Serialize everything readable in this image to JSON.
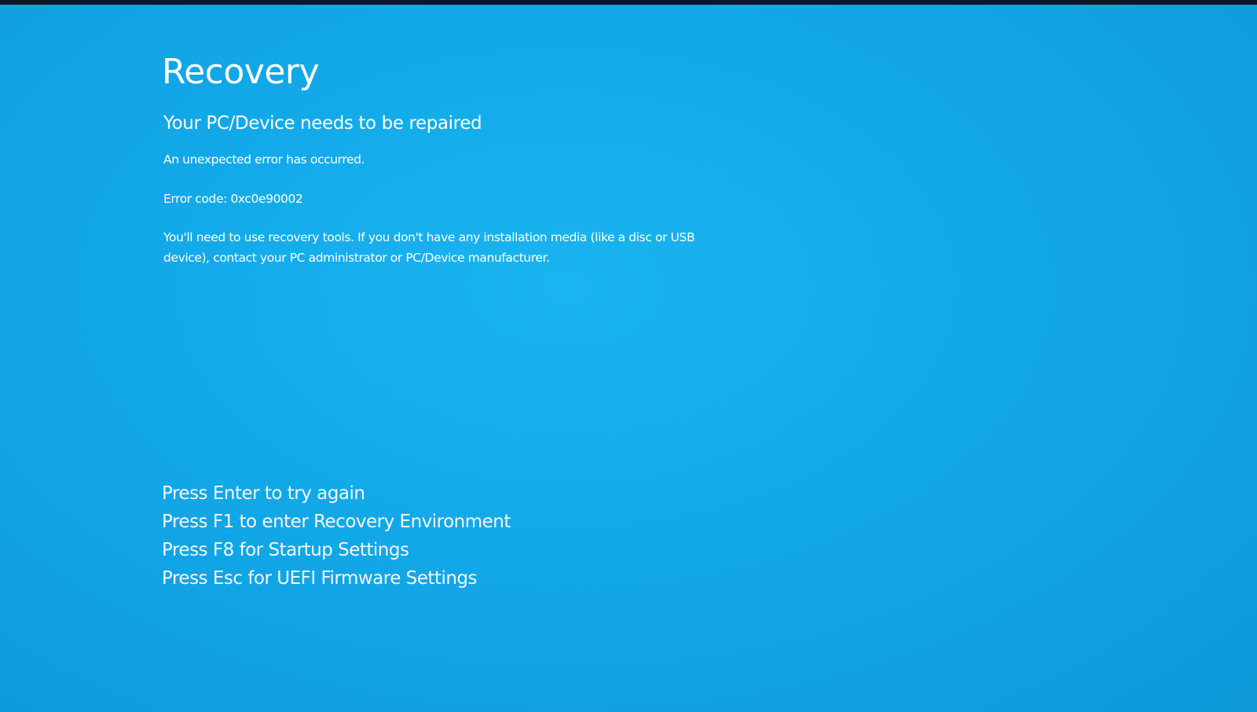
{
  "screen": {
    "title": "Recovery",
    "subtitle": "Your PC/Device needs to be repaired",
    "error_message": "An unexpected error has occurred.",
    "error_code": "Error code: 0xc0e90002",
    "tools_message": "You'll need to use recovery tools. If you don't have any installation media (like a disc or USB device), contact your PC administrator or PC/Device manufacturer."
  },
  "options": [
    "Press Enter to try again",
    "Press F1 to enter Recovery Environment",
    "Press F8 for Startup Settings",
    "Press Esc for UEFI Firmware Settings"
  ],
  "colors": {
    "background": "#12a8e8",
    "text": "#ffffff"
  }
}
